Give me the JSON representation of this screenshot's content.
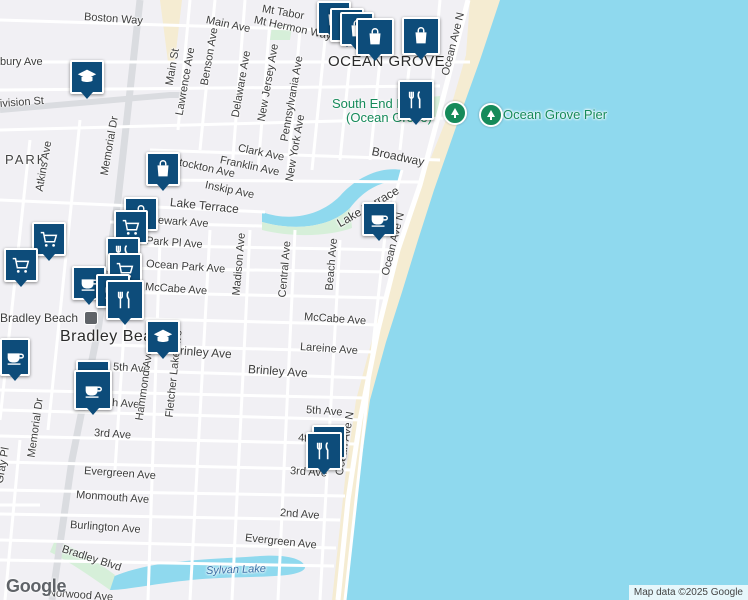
{
  "map": {
    "colors": {
      "land": "#f1f0f4",
      "water": "#8fd9ee",
      "sand": "#f5ecd2",
      "park": "#d6efd9",
      "road": "#ffffff",
      "pin": "#0d4c7a",
      "poi": "#168a5a"
    },
    "labels": {
      "town_ocean_grove": "OCEAN GROVE",
      "town_bradley_beach": "Bradley Beach",
      "nbh_park": "PARK",
      "boston_way": "Boston Way",
      "main_ave": "Main Ave",
      "mt_tabor": "Mt Tabor",
      "mt_hermon": "Mt Hermon Way",
      "bury_ave": "bury Ave",
      "division_st": "ivision St",
      "main_st": "Main St",
      "lawrence_ave": "Lawrence Ave",
      "benson_ave": "Benson Ave",
      "delaware_ave": "Delaware Ave",
      "new_jersey_ave": "New Jersey Ave",
      "pennsylvania_ave": "Pennsylvania Ave",
      "clark_ave": "Clark Ave",
      "new_york_ave": "New York Ave",
      "franklin_ave": "Franklin Ave",
      "stockton_ave": "Stockton Ave",
      "inskip_ave": "Inskip Ave",
      "broadway": "Broadway",
      "lake_terrace": "Lake Terrace",
      "lake_terrace_2": "Lake Terrace",
      "newark_ave": "Newark Ave",
      "park_pl_ave": "Park Pl Ave",
      "ocean_park_ave": "Ocean Park Ave",
      "mccabe_ave_w": "McCabe Ave",
      "mccabe_ave_e": "McCabe Ave",
      "lareine_ave": "Lareine Ave",
      "brinley_ave_w": "Brinley Ave",
      "brinley_ave_e": "Brinley Ave",
      "atkins_ave": "Atkins Ave",
      "memorial_dr": "Memorial Dr",
      "memorial_dr_2": "Memorial Dr",
      "madison_ave": "Madison Ave",
      "central_ave": "Central Ave",
      "beach_ave": "Beach Ave",
      "ocean_ave_n": "Ocean Ave N",
      "ocean_ave_n_2": "Ocean Ave N",
      "ocean_ave_n_3": "Ocean Ave N",
      "fifth_ave_w": "5th Ave",
      "fifth_ave_e": "5th Ave",
      "fourth_ave_w": "h Ave",
      "fourth_ave_e": "4th Ave",
      "third_ave_w": "3rd Ave",
      "third_ave_e": "3rd Ave",
      "second_ave": "2nd Ave",
      "hammond_ave": "Hammond Ave",
      "fletcher_lake_ave": "Fletcher Lake Ave",
      "evergreen_ave_w": "Evergreen Ave",
      "evergreen_ave_e": "Evergreen Ave",
      "monmouth_ave": "Monmouth Ave",
      "burlington_ave": "Burlington Ave",
      "bradley_blvd": "Bradley Blvd",
      "gray_pl": "Gray Pl",
      "sylvan_lake": "Sylvan Lake",
      "norwood_ave": "Norwood Ave",
      "poi_south_end": "South End Park",
      "poi_south_end_2": "(Ocean Grove)",
      "poi_pier": "Ocean Grove Pier",
      "bradley_beach_station": "Bradley Beach"
    },
    "logo": "Google",
    "attribution": "Map data ©2025 Google"
  }
}
